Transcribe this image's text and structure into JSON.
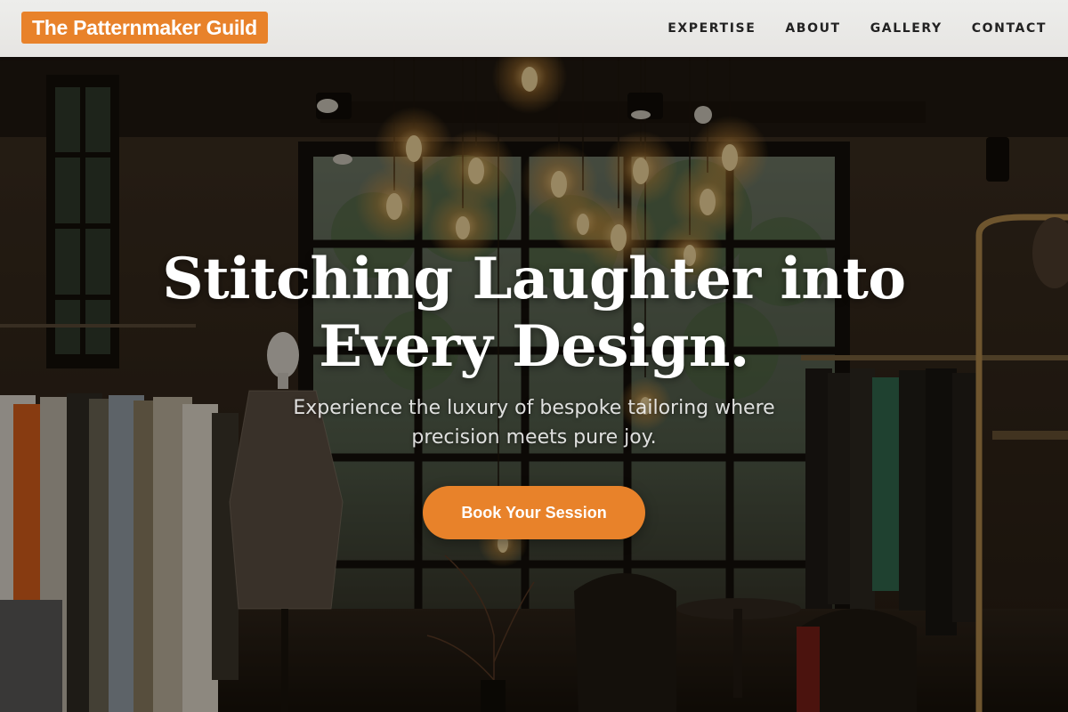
{
  "brand": {
    "name": "The Patternmaker Guild",
    "accent_color": "#e8822a"
  },
  "nav": {
    "items": [
      {
        "label": "EXPERTISE"
      },
      {
        "label": "ABOUT"
      },
      {
        "label": "GALLERY"
      },
      {
        "label": "CONTACT"
      }
    ]
  },
  "hero": {
    "title_line1": "Stitching Laughter into",
    "title_line2": "Every Design.",
    "subtitle_line1": "Experience the luxury of bespoke tailoring where",
    "subtitle_line2": "precision meets pure joy.",
    "cta_label": "Book Your Session",
    "background": "tailor-boutique-interior-photo"
  }
}
